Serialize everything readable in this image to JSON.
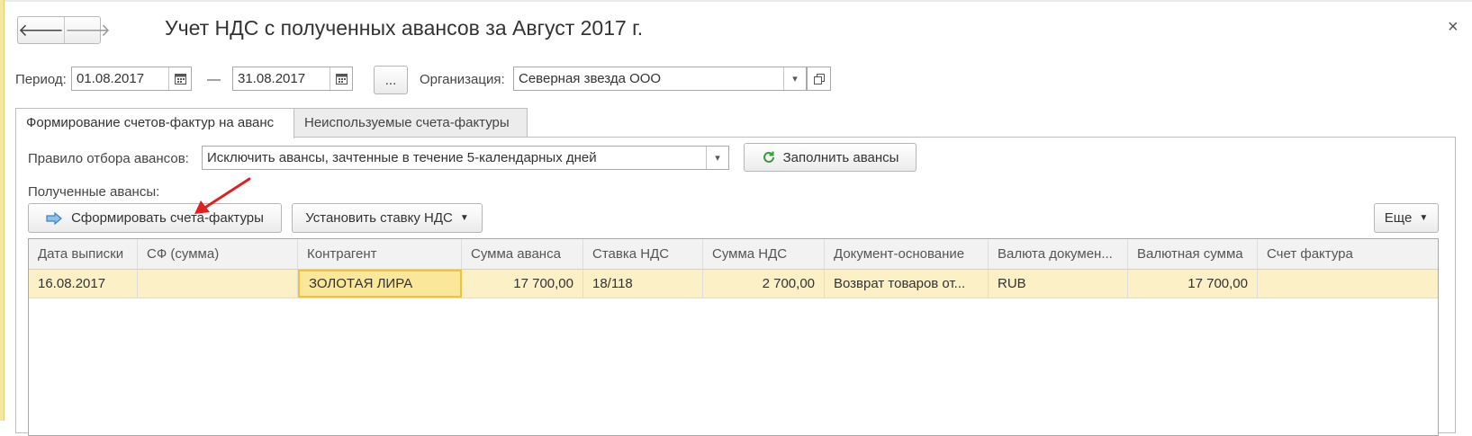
{
  "window": {
    "title": "Учет НДС с полученных авансов за Август 2017 г.",
    "close_glyph": "×",
    "back_glyph": "🡐",
    "forward_glyph": "🡒"
  },
  "filters": {
    "period_label": "Период:",
    "period_from": "01.08.2017",
    "dash": "—",
    "period_to": "31.08.2017",
    "more_button": "...",
    "org_label": "Организация:",
    "org_value": "Северная звезда ООО"
  },
  "tabs": [
    {
      "label": "Формирование счетов-фактур на аванс",
      "active": true
    },
    {
      "label": "Неиспользуемые счета-фактуры",
      "active": false
    }
  ],
  "panel": {
    "rule_label": "Правило отбора авансов:",
    "rule_value": "Исключить авансы, зачтенные в течение 5-календарных дней",
    "fill_button": "Заполнить авансы",
    "received_label": "Полученные авансы:",
    "create_invoices_button": "Сформировать счета-фактуры",
    "set_vat_button": "Установить ставку НДС",
    "more_menu_button": "Еще"
  },
  "table": {
    "columns": [
      "Дата выписки",
      "СФ (сумма)",
      "Контрагент",
      "Сумма аванса",
      "Ставка НДС",
      "Сумма НДС",
      "Документ-основание",
      "Валюта докумен...",
      "Валютная сумма",
      "Счет фактура"
    ],
    "rows": [
      [
        "16.08.2017",
        "",
        "ЗОЛОТАЯ ЛИРА",
        "17 700,00",
        "18/118",
        "2 700,00",
        "Возврат товаров от...",
        "RUB",
        "17 700,00",
        ""
      ]
    ]
  },
  "colors": {
    "selected_row": "#fbf0c6",
    "selected_cell_border": "#f0c13c",
    "annotation_arrow": "#e02020",
    "refresh_icon": "#3a9d3a",
    "arrow_icon": "#3b82c4"
  },
  "icons": {
    "calendar": "calendar-icon",
    "dropdown": "chevron-down-icon",
    "open_form": "open-form-icon",
    "refresh": "refresh-icon",
    "create": "arrow-right-icon"
  }
}
